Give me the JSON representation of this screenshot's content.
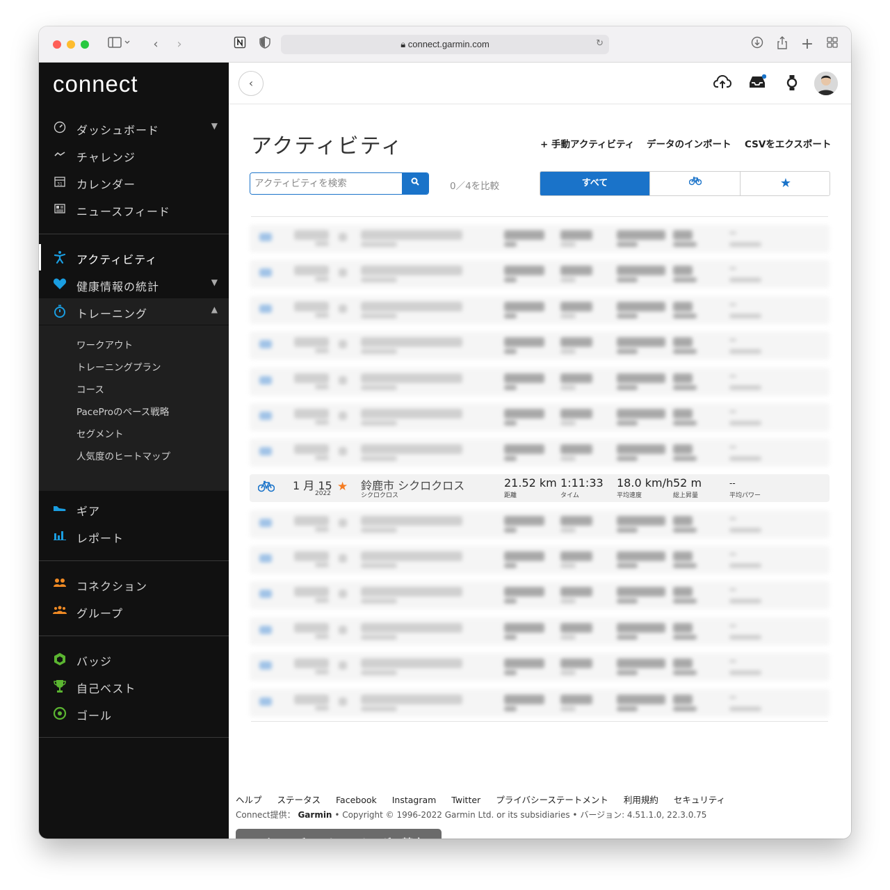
{
  "browser": {
    "url": "connect.garmin.com"
  },
  "sidebar": {
    "logo": "connect",
    "group1": [
      {
        "label": "ダッシュボード",
        "icon": "gauge-icon",
        "chevron": "⌄"
      },
      {
        "label": "チャレンジ",
        "icon": "challenge-icon"
      },
      {
        "label": "カレンダー",
        "icon": "calendar-icon"
      },
      {
        "label": "ニュースフィード",
        "icon": "newsfeed-icon"
      }
    ],
    "group2": [
      {
        "label": "アクティビティ",
        "icon": "running-icon",
        "active": true
      },
      {
        "label": "健康情報の統計",
        "icon": "heart-icon",
        "chevron": "⌄"
      },
      {
        "label": "トレーニング",
        "icon": "stopwatch-icon",
        "chevron": "⌃"
      }
    ],
    "training_sub": [
      "ワークアウト",
      "トレーニングプラン",
      "コース",
      "PaceProのペース戦略",
      "セグメント",
      "人気度のヒートマップ"
    ],
    "group3": [
      {
        "label": "ギア",
        "icon": "shoe-icon"
      },
      {
        "label": "レポート",
        "icon": "bar-chart-icon"
      }
    ],
    "group4": [
      {
        "label": "コネクション",
        "icon": "connections-icon"
      },
      {
        "label": "グループ",
        "icon": "groups-icon"
      }
    ],
    "group5": [
      {
        "label": "バッジ",
        "icon": "badge-icon"
      },
      {
        "label": "自己ベスト",
        "icon": "trophy-icon"
      },
      {
        "label": "ゴール",
        "icon": "goal-icon"
      }
    ]
  },
  "main": {
    "title": "アクティビティ",
    "links": {
      "manual": "+ 手動アクティビティ",
      "import": "データのインポート",
      "export": "CSVをエクスポート"
    },
    "search": {
      "placeholder": "アクティビティを検索"
    },
    "compare": "0／4を比較",
    "filters": {
      "all": "すべて",
      "bike_icon": "bicycle-icon",
      "fav_icon": "star-icon"
    },
    "highlighted_activity": {
      "date": "1 月 15",
      "year": "2022",
      "name": "鈴鹿市 シクロクロス",
      "type": "シクロクロス",
      "distance": "21.52 km",
      "distance_label": "距離",
      "time": "1:11:33",
      "time_label": "タイム",
      "speed": "18.0 km/h",
      "speed_label": "平均速度",
      "ascent": "52 m",
      "ascent_label": "総上昇量",
      "power": "--",
      "power_label": "平均パワー"
    }
  },
  "footer": {
    "links": [
      "ヘルプ",
      "ステータス",
      "Facebook",
      "Instagram",
      "Twitter",
      "プライバシーステートメント",
      "利用規約",
      "セキュリティ"
    ],
    "provided_by": "Connect提供：",
    "brand": "Garmin",
    "copyright": "• Copyright © 1996-2022 Garmin Ltd. or its subsidiaries • バージョン: 4.51.1.0, 22.3.0.75",
    "accuracy_button": "アクティビティトラッキングの精度"
  },
  "colors": {
    "accent": "#1a73c9",
    "sidebar_bg": "#111111",
    "star": "#f57c22"
  }
}
